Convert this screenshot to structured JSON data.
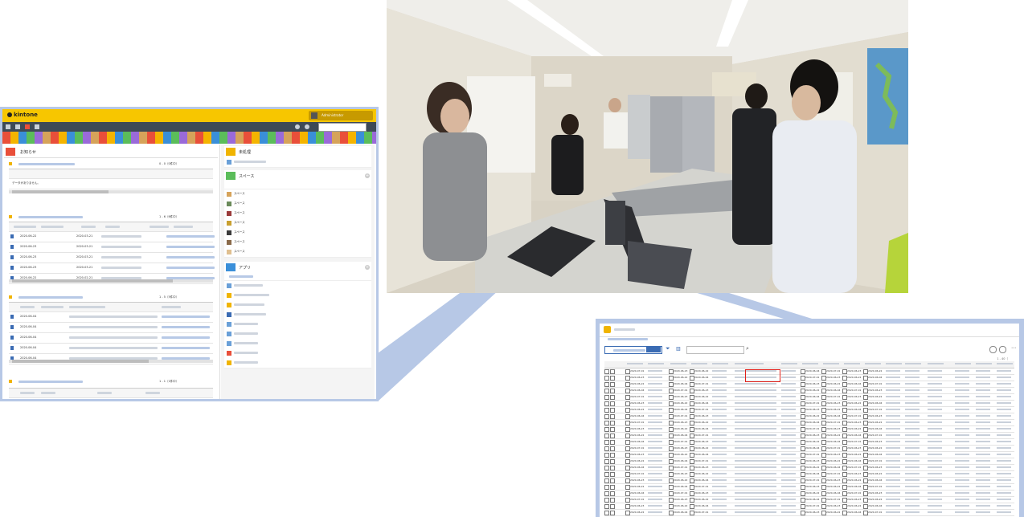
{
  "portal": {
    "logo": "kintone",
    "user": "Administrator",
    "search_placeholder": "",
    "notice": {
      "title": "お知らせ",
      "section1_title": "",
      "section1_count": "0 - 0（0件中）",
      "section1_headers": [
        "",
        "",
        ""
      ],
      "section1_empty": "データがありません。",
      "section2_title": "",
      "section2_count": "1 - 6（6件中）",
      "section2_headers": [
        "",
        "",
        "",
        "",
        "",
        ""
      ],
      "section2_dates": [
        "2020-06-22",
        "2020-06-23",
        "2020-06-23",
        "2020-06-23",
        "2020-06-22"
      ],
      "section2_dates2": [
        "2020-03-21",
        "2020-03-21",
        "2020-03-21",
        "2020-03-21",
        "2020-02-21"
      ],
      "section3_title": "",
      "section3_count": "1 - 5（5件中）",
      "section3_dates": [
        "2020-06-04",
        "2020-06-04",
        "2020-06-04",
        "2020-06-04",
        "2020-06-04"
      ],
      "section4_title": "",
      "section4_count": "1 - 1（1件中）"
    },
    "side": {
      "unprocessed_title": "未処理",
      "spaces_title": "スペース",
      "space_items": [
        "",
        "スペース",
        "スペース",
        "スペース",
        "スペース",
        "スペース",
        "スペース",
        "スペース"
      ],
      "apps_title": "アプリ"
    }
  },
  "records": {
    "app_title": "",
    "breadcrumb": "",
    "view_label": "",
    "count": "1 - 40（",
    "columns": [
      "",
      "",
      "",
      "",
      "",
      "",
      "",
      "",
      "",
      "",
      "",
      "",
      "",
      "",
      "",
      "",
      ""
    ],
    "row_ids": [
      "",
      "",
      "",
      "",
      "",
      "",
      "",
      "",
      "",
      "",
      "",
      "",
      "",
      "",
      "",
      "",
      "",
      "",
      "",
      "",
      "",
      "",
      "",
      "",
      "",
      "",
      "",
      "",
      "",
      "",
      "",
      "",
      "",
      "",
      "",
      "",
      "",
      "",
      "",
      "",
      "",
      "",
      "",
      "",
      "",
      "",
      "",
      "",
      "",
      "",
      "",
      "",
      "",
      "",
      "",
      "",
      "",
      "",
      "",
      "",
      "",
      "",
      "",
      "",
      "",
      "",
      "",
      "",
      "",
      "",
      "",
      "",
      "",
      "",
      "",
      "",
      "",
      "",
      "",
      "",
      "",
      ""
    ],
    "date_cells": [
      "2020-07-01",
      "2020-06-23",
      "2020-06-22",
      "2020-06-04"
    ]
  },
  "colors": {
    "frame": "#b7c8e6",
    "kintone_yellow": "#f7c600",
    "link_blue": "#3a6bb3",
    "highlight": "#e0201a"
  }
}
